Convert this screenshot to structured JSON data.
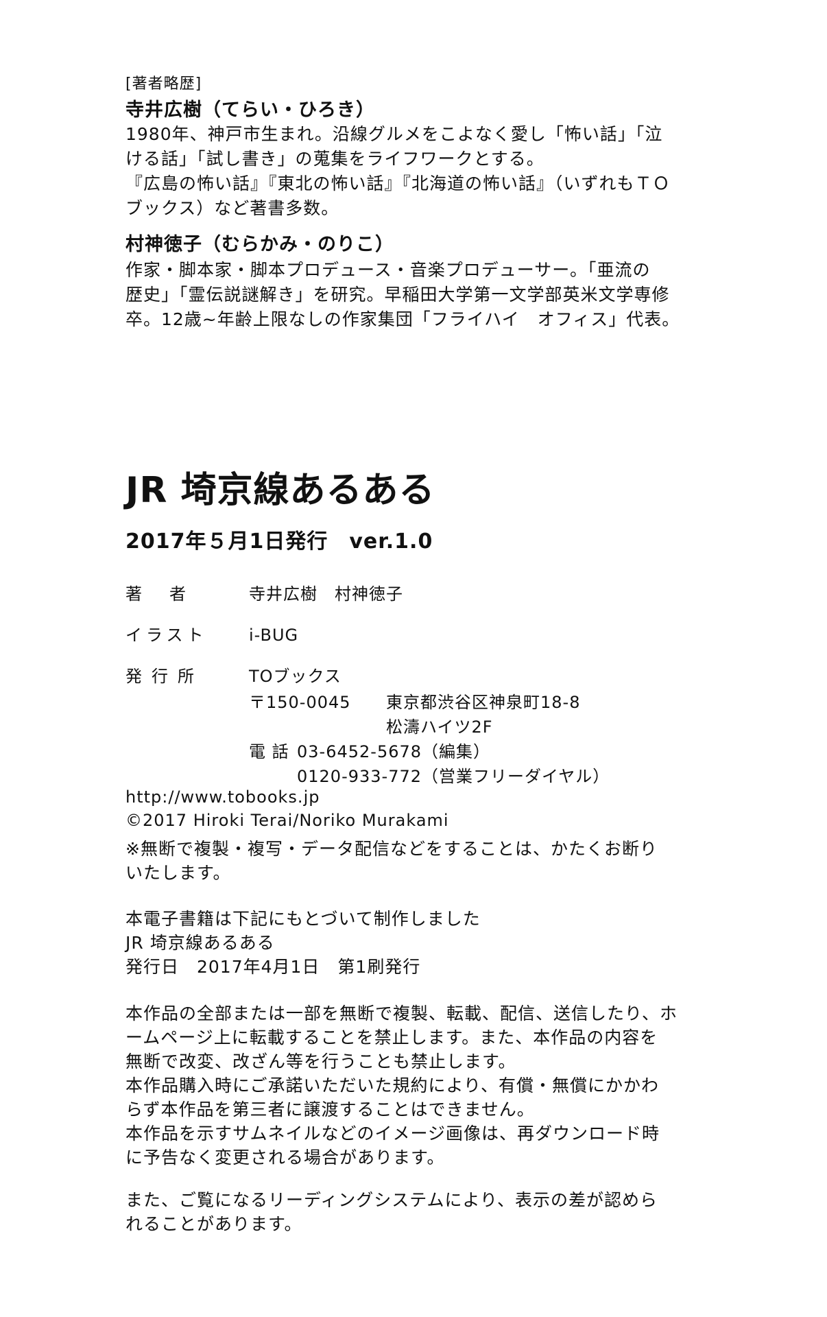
{
  "about_authors": {
    "label": "[著者略歴]",
    "authors": [
      {
        "name": "寺井広樹（てらい・ひろき）",
        "bio": [
          "1980年、神戸市生まれ。沿線グルメをこよなく愛し「怖い話」「泣",
          "ける話」「試し書き」の蒐集をライフワークとする。",
          "『広島の怖い話』『東北の怖い話』『北海道の怖い話』（いずれもＴＯ",
          "ブックス）など著書多数。"
        ]
      },
      {
        "name": "村神徳子（むらかみ・のりこ）",
        "bio": [
          "作家・脚本家・脚本プロデュース・音楽プロデューサー。「亜流の",
          "歴史」「霊伝説謎解き」を研究。早稲田大学第一文学部英米文学専修",
          "卒。12歳~年齢上限なしの作家集団「フライハイ　オフィス」代表。"
        ]
      }
    ]
  },
  "colophon": {
    "title": "JR 埼京線あるある",
    "date_line": "2017年５月1日発行　ver.1.0",
    "credits": [
      {
        "label": "著者",
        "value": "寺井広樹　村神徳子"
      },
      {
        "label": "イラスト",
        "value": "i-BUG"
      },
      {
        "label": "発行所",
        "value": "TOブックス"
      }
    ],
    "address": {
      "postal": "〒150-0045",
      "line1": "東京都渋谷区神泉町18-8",
      "line2": "松濤ハイツ2F"
    },
    "phone": {
      "prefix": "電 話",
      "editorial": "03-6452-5678（編集）",
      "sales": "0120-933-772（営業フリーダイヤル）"
    },
    "url": "http://www.tobooks.jp",
    "copyright": "©2017 Hiroki Terai/Noriko Murakami",
    "notice": [
      "※無断で複製・複写・データ配信などをすることは、かたくお断り",
      "いたします。"
    ]
  },
  "ebook_info": {
    "intro": "本電子書籍は下記にもとづいて制作しました",
    "source_title": "JR 埼京線あるある",
    "source_date": "発行日　2017年4月1日　第1刷発行"
  },
  "terms": {
    "paragraph1": [
      "本作品の全部または一部を無断で複製、転載、配信、送信したり、ホ",
      "ームページ上に転載することを禁止します。また、本作品の内容を",
      "無断で改変、改ざん等を行うことも禁止します。",
      "本作品購入時にご承諾いただいた規約により、有償・無償にかかわ",
      "らず本作品を第三者に譲渡することはできません。",
      "本作品を示すサムネイルなどのイメージ画像は、再ダウンロード時",
      "に予告なく変更される場合があります。"
    ],
    "paragraph2": [
      "また、ご覧になるリーディングシステムにより、表示の差が認めら",
      "れることがあります。"
    ]
  }
}
